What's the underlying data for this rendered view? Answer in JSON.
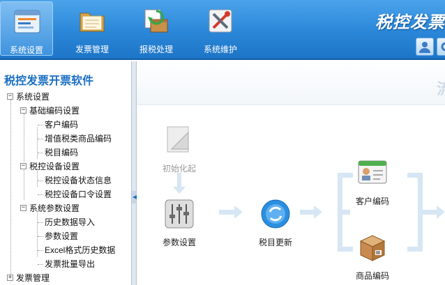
{
  "toolbar": {
    "buttons": [
      {
        "label": "系统设置",
        "icon": "settings-panel-icon",
        "active": true
      },
      {
        "label": "发票管理",
        "icon": "folder-icon",
        "active": false
      },
      {
        "label": "报税处理",
        "icon": "tax-box-icon",
        "active": false
      },
      {
        "label": "系统维护",
        "icon": "tools-icon",
        "active": false
      }
    ],
    "brand": "税控发票开",
    "accent": "#2a86d8"
  },
  "sidebar": {
    "title": "税控发票开票软件",
    "tree": {
      "root": "系统设置",
      "groups": [
        {
          "label": "基础编码设置",
          "items": [
            "客户编码",
            "增值税类商品编码",
            "税目编码"
          ]
        },
        {
          "label": "税控设备设置",
          "items": [
            "税控设备状态信息",
            "税控设备口令设置"
          ]
        },
        {
          "label": "系统参数设置",
          "items": [
            "历史数据导入",
            "参数设置",
            "Excel格式历史数据",
            "发票批量导出"
          ]
        }
      ],
      "next_root": "发票管理"
    }
  },
  "main": {
    "header_text": "流",
    "flow": {
      "init": "初始化起",
      "params": "参数设置",
      "update": "税目更新",
      "customer": "客户编码",
      "goods": "商品编码"
    }
  }
}
